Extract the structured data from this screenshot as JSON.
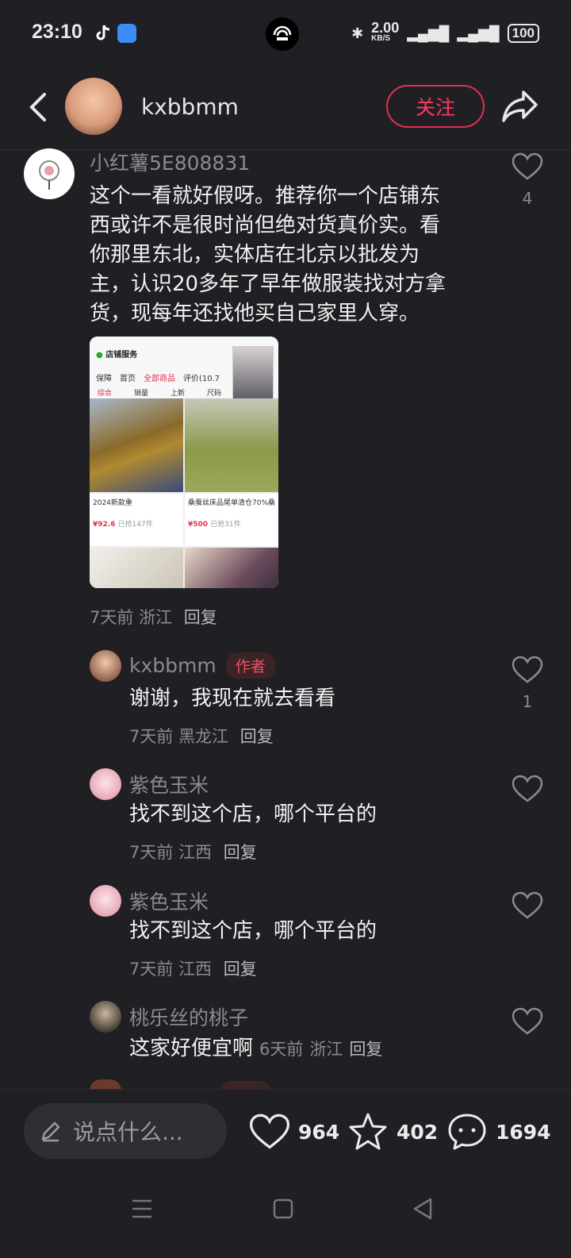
{
  "status_bar": {
    "time": "23:10",
    "network_speed": "2.00",
    "network_unit": "KB/S",
    "battery": "100"
  },
  "header": {
    "username": "kxbbmm",
    "follow_label": "关注"
  },
  "comments": [
    {
      "name": "小红薯5E808831",
      "text_lines": [
        "这个一看就好假呀。推荐你一个店铺东",
        "西或许不是很时尚但绝对货真价实。看",
        "你那里东北，实体店在北京以批发为",
        "主，认识20多年了早年做服装找对方拿",
        "货，现每年还找他买自己家里人穿。"
      ],
      "time": "7天前",
      "location": "浙江",
      "reply": "回复",
      "likes": "4"
    }
  ],
  "shot": {
    "store_label": "店铺服务",
    "tabs": [
      "保障",
      "首页",
      "全部商品",
      "评价(10.7"
    ],
    "filters": [
      "综合",
      "销量",
      "上新",
      "尺码"
    ],
    "item1_title": "2024新款重",
    "item1_price": "¥92.6",
    "item1_sold": "已抢147件",
    "item2_title": "桑蚕丝床品尾单清仓70%桑",
    "item2_price": "¥500",
    "item2_sold": "已抢31件"
  },
  "replies": [
    {
      "name": "kxbbmm",
      "tag": "作者",
      "text": "谢谢，我现在就去看看",
      "time": "7天前",
      "location": "黑龙江",
      "reply": "回复",
      "likes": "1"
    },
    {
      "name": "紫色玉米",
      "text": "找不到这个店，哪个平台的",
      "time": "7天前",
      "location": "江西",
      "reply": "回复",
      "likes": ""
    },
    {
      "name": "紫色玉米",
      "text": "找不到这个店，哪个平台的",
      "time": "7天前",
      "location": "江西",
      "reply": "回复",
      "likes": ""
    },
    {
      "name": "桃乐丝的桃子",
      "text": "这家好便宜啊",
      "time": "6天前",
      "location": "浙江",
      "reply": "回复",
      "likes": ""
    }
  ],
  "bottom": {
    "input_placeholder": "说点什么...",
    "likes": "964",
    "stars": "402",
    "comments": "1694"
  },
  "colors": {
    "accent": "#ff3a5a",
    "background": "#1f1f24"
  }
}
